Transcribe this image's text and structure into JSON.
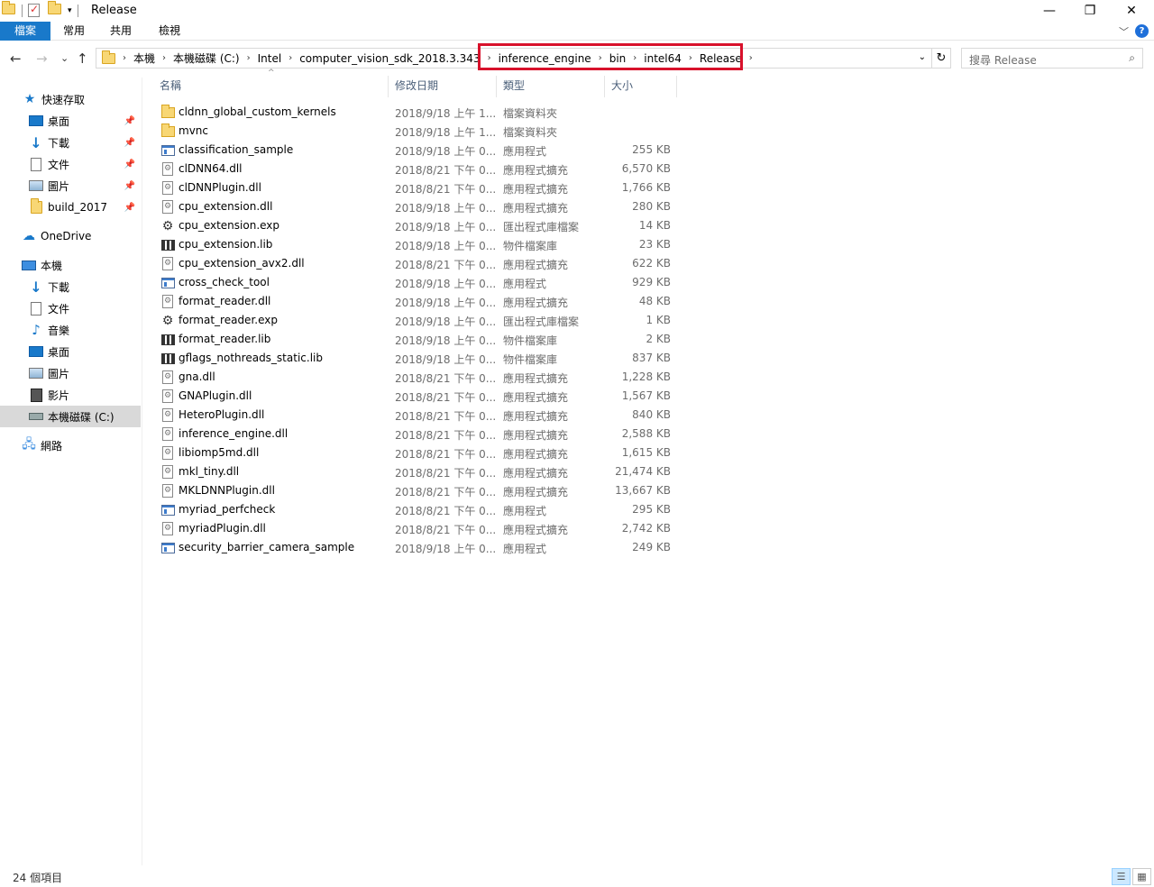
{
  "window": {
    "title": "Release",
    "minimize": "—",
    "restore": "❐",
    "close": "✕"
  },
  "ribbon": {
    "tabs": [
      "檔案",
      "常用",
      "共用",
      "檢視"
    ],
    "help": "?",
    "expand": "﹀"
  },
  "nav": {
    "back": "←",
    "forward": "→",
    "recent": "⌄",
    "up": "↑",
    "breadcrumb": [
      "本機",
      "本機磁碟 (C:)",
      "Intel",
      "computer_vision_sdk_2018.3.343",
      "inference_engine",
      "bin",
      "intel64",
      "Release"
    ],
    "refresh": "↻",
    "search_placeholder": "搜尋 Release",
    "search_icon": "⌕"
  },
  "sidebar": {
    "quick_access": "快速存取",
    "quick_items": [
      {
        "label": "桌面",
        "icon": "desktop-icon"
      },
      {
        "label": "下載",
        "icon": "download-icon"
      },
      {
        "label": "文件",
        "icon": "documents-icon"
      },
      {
        "label": "圖片",
        "icon": "pictures-icon"
      },
      {
        "label": "build_2017",
        "icon": "folder-icon"
      }
    ],
    "onedrive": "OneDrive",
    "this_pc": "本機",
    "pc_items": [
      {
        "label": "下載",
        "icon": "download-icon"
      },
      {
        "label": "文件",
        "icon": "documents-icon"
      },
      {
        "label": "音樂",
        "icon": "music-icon"
      },
      {
        "label": "桌面",
        "icon": "desktop-icon"
      },
      {
        "label": "圖片",
        "icon": "pictures-icon"
      },
      {
        "label": "影片",
        "icon": "videos-icon"
      },
      {
        "label": "本機磁碟 (C:)",
        "icon": "drive-icon"
      }
    ],
    "network": "網路"
  },
  "columns": {
    "name": "名稱",
    "date": "修改日期",
    "type": "類型",
    "size": "大小"
  },
  "files": [
    {
      "name": "cldnn_global_custom_kernels",
      "date": "2018/9/18 上午 1...",
      "type": "檔案資料夾",
      "size": "",
      "kind": "folder"
    },
    {
      "name": "mvnc",
      "date": "2018/9/18 上午 1...",
      "type": "檔案資料夾",
      "size": "",
      "kind": "folder"
    },
    {
      "name": "classification_sample",
      "date": "2018/9/18 上午 0...",
      "type": "應用程式",
      "size": "255 KB",
      "kind": "exe"
    },
    {
      "name": "clDNN64.dll",
      "date": "2018/8/21 下午 0...",
      "type": "應用程式擴充",
      "size": "6,570 KB",
      "kind": "dll"
    },
    {
      "name": "clDNNPlugin.dll",
      "date": "2018/8/21 下午 0...",
      "type": "應用程式擴充",
      "size": "1,766 KB",
      "kind": "dll"
    },
    {
      "name": "cpu_extension.dll",
      "date": "2018/9/18 上午 0...",
      "type": "應用程式擴充",
      "size": "280 KB",
      "kind": "dll"
    },
    {
      "name": "cpu_extension.exp",
      "date": "2018/9/18 上午 0...",
      "type": "匯出程式庫檔案",
      "size": "14 KB",
      "kind": "exp"
    },
    {
      "name": "cpu_extension.lib",
      "date": "2018/9/18 上午 0...",
      "type": "物件檔案庫",
      "size": "23 KB",
      "kind": "lib"
    },
    {
      "name": "cpu_extension_avx2.dll",
      "date": "2018/8/21 下午 0...",
      "type": "應用程式擴充",
      "size": "622 KB",
      "kind": "dll"
    },
    {
      "name": "cross_check_tool",
      "date": "2018/9/18 上午 0...",
      "type": "應用程式",
      "size": "929 KB",
      "kind": "exe"
    },
    {
      "name": "format_reader.dll",
      "date": "2018/9/18 上午 0...",
      "type": "應用程式擴充",
      "size": "48 KB",
      "kind": "dll"
    },
    {
      "name": "format_reader.exp",
      "date": "2018/9/18 上午 0...",
      "type": "匯出程式庫檔案",
      "size": "1 KB",
      "kind": "exp"
    },
    {
      "name": "format_reader.lib",
      "date": "2018/9/18 上午 0...",
      "type": "物件檔案庫",
      "size": "2 KB",
      "kind": "lib"
    },
    {
      "name": "gflags_nothreads_static.lib",
      "date": "2018/9/18 上午 0...",
      "type": "物件檔案庫",
      "size": "837 KB",
      "kind": "lib"
    },
    {
      "name": "gna.dll",
      "date": "2018/8/21 下午 0...",
      "type": "應用程式擴充",
      "size": "1,228 KB",
      "kind": "dll"
    },
    {
      "name": "GNAPlugin.dll",
      "date": "2018/8/21 下午 0...",
      "type": "應用程式擴充",
      "size": "1,567 KB",
      "kind": "dll"
    },
    {
      "name": "HeteroPlugin.dll",
      "date": "2018/8/21 下午 0...",
      "type": "應用程式擴充",
      "size": "840 KB",
      "kind": "dll"
    },
    {
      "name": "inference_engine.dll",
      "date": "2018/8/21 下午 0...",
      "type": "應用程式擴充",
      "size": "2,588 KB",
      "kind": "dll"
    },
    {
      "name": "libiomp5md.dll",
      "date": "2018/8/21 下午 0...",
      "type": "應用程式擴充",
      "size": "1,615 KB",
      "kind": "dll"
    },
    {
      "name": "mkl_tiny.dll",
      "date": "2018/8/21 下午 0...",
      "type": "應用程式擴充",
      "size": "21,474 KB",
      "kind": "dll"
    },
    {
      "name": "MKLDNNPlugin.dll",
      "date": "2018/8/21 下午 0...",
      "type": "應用程式擴充",
      "size": "13,667 KB",
      "kind": "dll"
    },
    {
      "name": "myriad_perfcheck",
      "date": "2018/8/21 下午 0...",
      "type": "應用程式",
      "size": "295 KB",
      "kind": "exe"
    },
    {
      "name": "myriadPlugin.dll",
      "date": "2018/8/21 下午 0...",
      "type": "應用程式擴充",
      "size": "2,742 KB",
      "kind": "dll"
    },
    {
      "name": "security_barrier_camera_sample",
      "date": "2018/9/18 上午 0...",
      "type": "應用程式",
      "size": "249 KB",
      "kind": "exe"
    }
  ],
  "status": {
    "count": "24 個項目"
  },
  "colors": {
    "file_tab": "#1979ca",
    "highlight_box": "#d8112b",
    "selected_nav": "#d9d9d9"
  }
}
